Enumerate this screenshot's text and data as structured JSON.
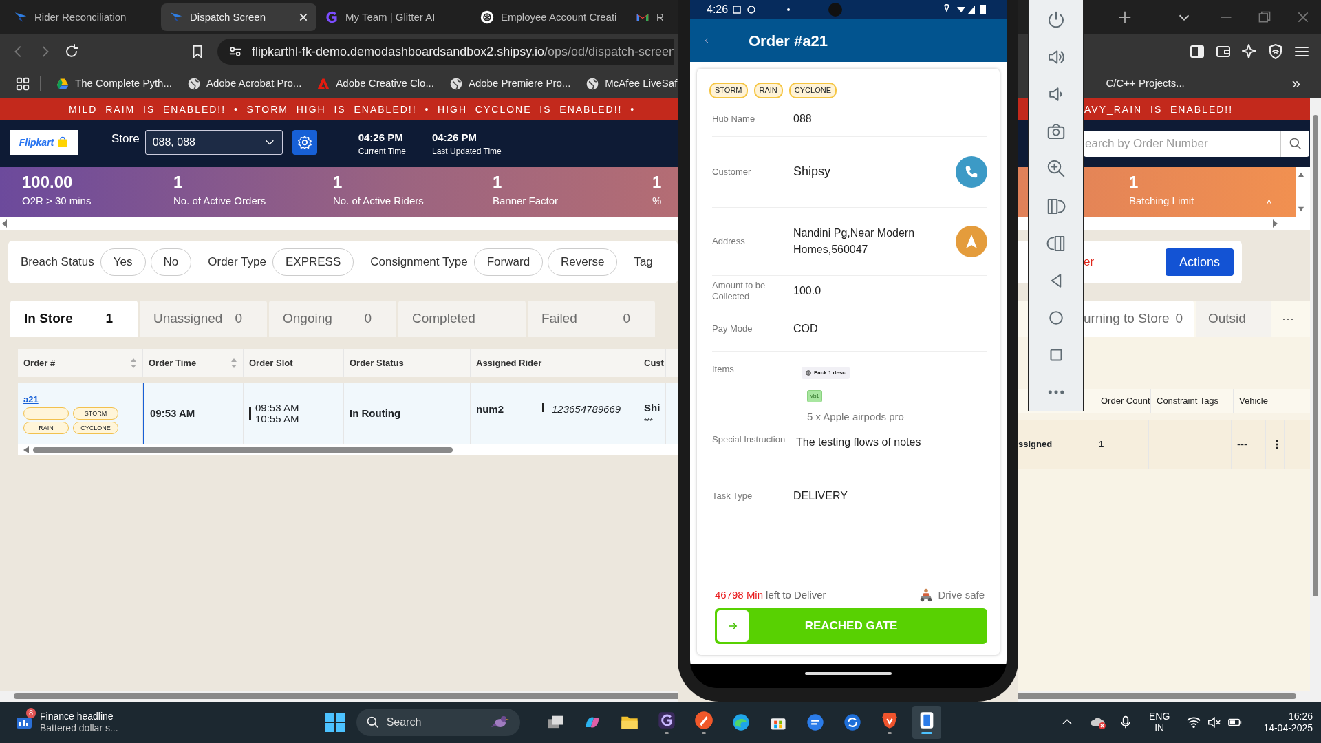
{
  "browser": {
    "tabs": [
      {
        "title": "Rider Reconciliation",
        "selected": false
      },
      {
        "title": "Dispatch Screen",
        "selected": true
      },
      {
        "title": "My Team | Glitter AI",
        "selected": false
      },
      {
        "title": "Employee Account Creati",
        "selected": false
      },
      {
        "title": "R",
        "selected": false
      }
    ],
    "url_host": "flipkarthl-fk-demo.demodashboardsandbox2.shipsy.io",
    "url_path": "/ops/od/dispatch-screen",
    "bookmarks": [
      "The Complete Pyth...",
      "Adobe Acrobat Pro...",
      "Adobe Creative Clo...",
      "Adobe Premiere Pro...",
      "McAfee LiveSaf"
    ],
    "bookmarks_right": "C/C++ Projects...",
    "bookmarks_more": "»"
  },
  "banner": {
    "left": "MILD  RAIM  IS  ENABLED!!  •  STORM  HIGH  IS  ENABLED!!  •  HIGH  CYCLONE  IS  ENABLED!!  •",
    "right": "AVY_RAIN  IS  ENABLED!!"
  },
  "header": {
    "logo": "Flipkart",
    "store_label": "Store",
    "store_value": "088, 088",
    "times": [
      {
        "value": "04:26 PM",
        "label": "Current Time"
      },
      {
        "value": "04:26 PM",
        "label": "Last Updated Time"
      }
    ],
    "search_placeholder": "earch by Order Number"
  },
  "stats": [
    {
      "value": "100.00",
      "label": "O2R > 30 mins"
    },
    {
      "value": "1",
      "label": "No. of Active Orders"
    },
    {
      "value": "1",
      "label": "No. of Active Riders"
    },
    {
      "value": "1",
      "label": "Banner Factor"
    },
    {
      "value": "1",
      "label": "%"
    }
  ],
  "stats_right": {
    "value": "1",
    "label": "Batching Limit",
    "toggle": "^"
  },
  "filters": [
    {
      "label": "Breach Status",
      "options": [
        "Yes",
        "No"
      ]
    },
    {
      "label": "Order Type",
      "options": [
        "EXPRESS"
      ]
    },
    {
      "label": "Consignment Type",
      "options": [
        "Forward",
        "Reverse"
      ]
    },
    {
      "label": "Tag"
    }
  ],
  "filters_right": {
    "text": "er",
    "actions": "Actions"
  },
  "status_tabs": [
    {
      "label": "In Store",
      "count": "1",
      "selected": true
    },
    {
      "label": "Unassigned",
      "count": "0",
      "selected": false
    },
    {
      "label": "Ongoing",
      "count": "0",
      "selected": false
    },
    {
      "label": "Completed",
      "selected": false
    },
    {
      "label": "Failed",
      "count": "0",
      "selected": false
    }
  ],
  "status_tabs_right": [
    {
      "label": "urning to Store",
      "count": "0"
    },
    {
      "label": "Outsid"
    }
  ],
  "status_tabs_more": "···",
  "orders_table": {
    "columns": [
      {
        "label": "Order #",
        "sortable": true
      },
      {
        "label": "Order Time",
        "sortable": true
      },
      {
        "label": "Order Slot",
        "sortable": false
      },
      {
        "label": "Order Status",
        "sortable": false
      },
      {
        "label": "Assigned Rider",
        "sortable": false
      },
      {
        "label": "Cust",
        "sortable": false
      }
    ],
    "rows": [
      {
        "order": "a21",
        "tags": [
          {
            "kind": "blank"
          },
          {
            "kind": "text",
            "label": "STORM"
          },
          {
            "kind": "text",
            "label": "RAIN"
          },
          {
            "kind": "text",
            "label": "CYCLONE"
          }
        ],
        "order_time": "09:53 AM",
        "slot_start": "09:53 AM",
        "slot_end": "10:55 AM",
        "status": "In Routing",
        "rider": "num2",
        "rider_phone": "123654789669",
        "customer": "Shi",
        "customer_sub": "***"
      }
    ]
  },
  "riders_table": {
    "columns": [
      "Order Count",
      "Constraint Tags",
      "Vehicle"
    ],
    "rows": [
      {
        "status": "ssigned",
        "order_count": "1",
        "vehicle": "---"
      }
    ]
  },
  "phone": {
    "status_time": "4:26",
    "title": "Order #a21",
    "tags": [
      "STORM",
      "RAIN",
      "CYCLONE"
    ],
    "fields": [
      {
        "kind": "text",
        "label": "Hub Name",
        "value": "088"
      },
      {
        "kind": "call",
        "label": "Customer",
        "value": "Shipsy"
      },
      {
        "kind": "navigate",
        "label": "Address",
        "value": "Nandini Pg,Near Modern Homes,560047"
      },
      {
        "kind": "text",
        "label": "Amount to be Collected",
        "value": "100.0"
      },
      {
        "kind": "text",
        "label": "Pay Mode",
        "value": "COD"
      },
      {
        "kind": "items",
        "label": "Items",
        "pack": "Pack 1 desc",
        "chip": "vls1",
        "item": "5 x Apple airpods pro"
      },
      {
        "kind": "text",
        "label": "Special Instruction",
        "value": "The testing flows of notes"
      },
      {
        "kind": "text",
        "label": "Task Type",
        "value": "DELIVERY"
      }
    ],
    "timer_value": "46798 Min",
    "timer_text": "left to Deliver",
    "drive_safe": "Drive safe",
    "action": "REACHED GATE"
  },
  "taskbar": {
    "weather_badge": "8",
    "news_title": "Finance headline",
    "news_sub": "Battered dollar s...",
    "search": "Search",
    "apps": [
      {
        "running": false,
        "selected": false
      },
      {
        "running": false,
        "selected": false
      },
      {
        "running": false,
        "selected": false
      },
      {
        "running": true,
        "selected": false
      },
      {
        "running": true,
        "selected": false
      },
      {
        "running": false,
        "selected": false
      },
      {
        "running": false,
        "selected": false
      },
      {
        "running": false,
        "selected": false
      },
      {
        "running": false,
        "selected": false
      },
      {
        "running": true,
        "selected": false
      },
      {
        "running": true,
        "selected": true
      }
    ],
    "lang": "ENG",
    "region": "IN",
    "time": "16:26",
    "date": "14-04-2025"
  }
}
